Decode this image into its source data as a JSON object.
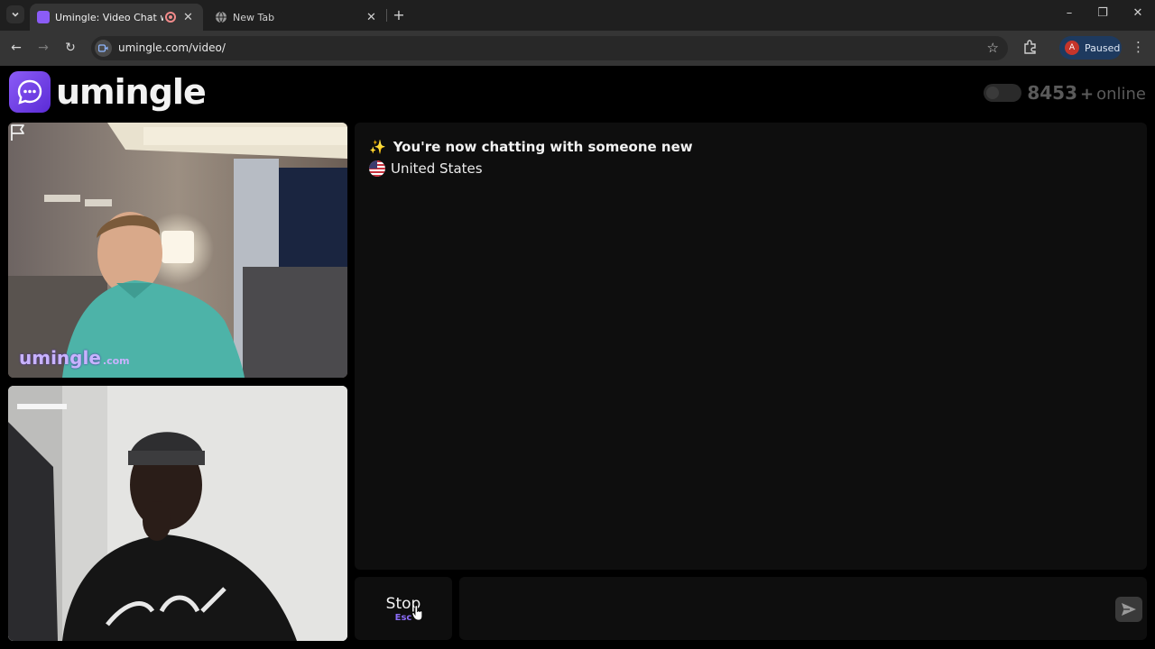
{
  "browser": {
    "tabs": [
      {
        "title": "Umingle: Video Chat with St",
        "active": true
      },
      {
        "title": "New Tab",
        "active": false
      }
    ],
    "url": "umingle.com/video/",
    "profile_initial": "A",
    "profile_status": "Paused"
  },
  "header": {
    "brand_name": "umingle",
    "online_count": "8453",
    "online_plus": "+",
    "online_label": "online"
  },
  "remote_video": {
    "watermark_main": "umingle",
    "watermark_suffix": ".com"
  },
  "chat": {
    "status_icon": "✨",
    "status_message": "You're now chatting with someone new",
    "partner_country": "United States",
    "input_value": ""
  },
  "controls": {
    "stop_label": "Stop",
    "stop_shortcut": "Esc"
  },
  "colors": {
    "accent": "#8b5cf6",
    "page_bg": "#000000",
    "panel_bg": "#0e0e0e"
  }
}
